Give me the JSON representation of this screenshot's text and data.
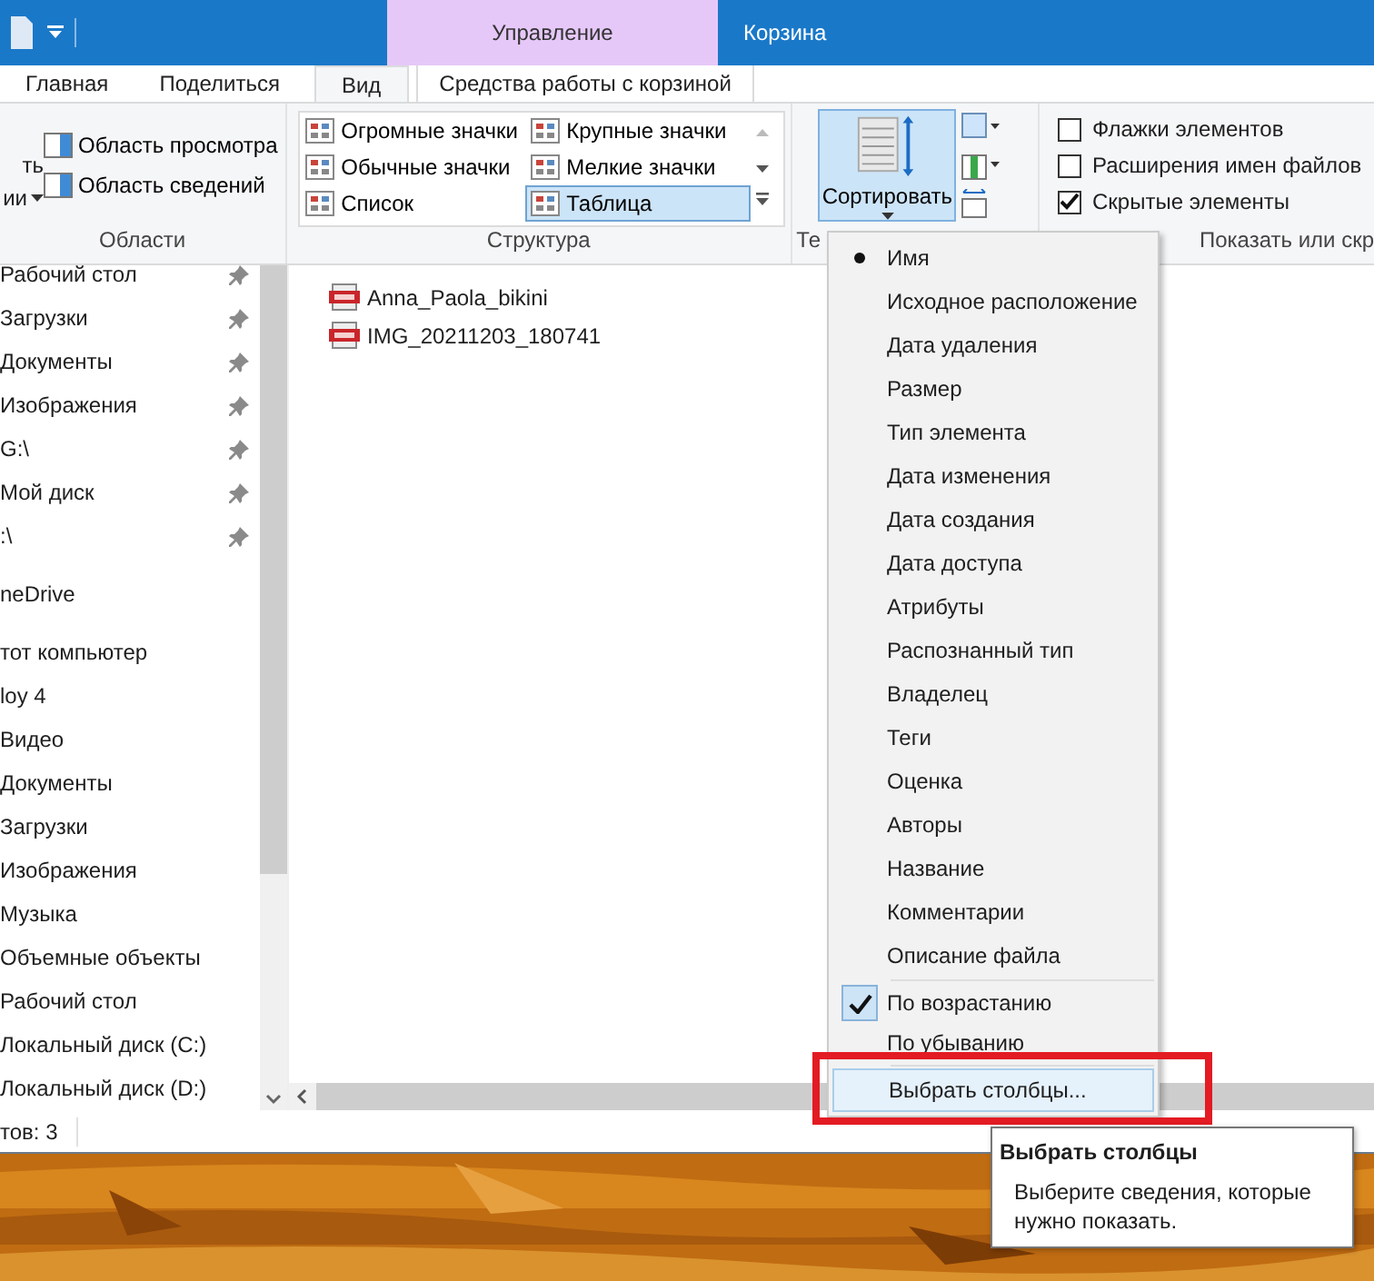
{
  "window": {
    "contextual_group": "Управление",
    "title": "Корзина"
  },
  "tabs": [
    {
      "label": "Главная",
      "selected": false
    },
    {
      "label": "Поделиться",
      "selected": false
    },
    {
      "label": "Вид",
      "selected": true
    },
    {
      "label": "Средства работы с корзиной",
      "selected": false
    }
  ],
  "ribbon": {
    "panes_group": {
      "label": "Области",
      "cut_button": [
        "ть",
        "ии"
      ],
      "buttons": [
        "Область просмотра",
        "Область сведений"
      ]
    },
    "layout_group": {
      "label": "Структура",
      "options": [
        {
          "label": "Огромные значки",
          "selected": false
        },
        {
          "label": "Крупные значки",
          "selected": false
        },
        {
          "label": "Обычные значки",
          "selected": false
        },
        {
          "label": "Мелкие значки",
          "selected": false
        },
        {
          "label": "Список",
          "selected": false
        },
        {
          "label": "Таблица",
          "selected": true
        }
      ]
    },
    "view_group": {
      "label": "Те",
      "sort_button": "Сортировать"
    },
    "show_group": {
      "label": "Показать или скр",
      "checkboxes": [
        {
          "label": "Флажки элементов",
          "checked": false
        },
        {
          "label": "Расширения имен файлов",
          "checked": false
        },
        {
          "label": "Скрытые элементы",
          "checked": true
        }
      ]
    }
  },
  "nav": [
    {
      "items": [
        {
          "label": "Рабочий стол",
          "pinned": true
        },
        {
          "label": "Загрузки",
          "pinned": true
        },
        {
          "label": "Документы",
          "pinned": true
        },
        {
          "label": "Изображения",
          "pinned": true
        },
        {
          "label": "G:\\",
          "pinned": true
        },
        {
          "label": "Мой диск",
          "pinned": true
        },
        {
          "label": ":\\",
          "pinned": true
        }
      ]
    },
    {
      "items": [
        {
          "label": "neDrive",
          "pinned": false
        }
      ]
    },
    {
      "items": [
        {
          "label": "тот компьютер",
          "pinned": false
        },
        {
          "label": "loy 4",
          "pinned": false
        },
        {
          "label": "Видео",
          "pinned": false
        },
        {
          "label": "Документы",
          "pinned": false
        },
        {
          "label": "Загрузки",
          "pinned": false
        },
        {
          "label": "Изображения",
          "pinned": false
        },
        {
          "label": "Музыка",
          "pinned": false
        },
        {
          "label": "Объемные объекты",
          "pinned": false
        },
        {
          "label": "Рабочий стол",
          "pinned": false
        },
        {
          "label": "Локальный диск (C:)",
          "pinned": false
        },
        {
          "label": "Локальный диск (D:)",
          "pinned": false
        }
      ]
    }
  ],
  "files": [
    {
      "name": "Anna_Paola_bikini"
    },
    {
      "name": "IMG_20211203_180741"
    }
  ],
  "status_bar": "тов: 3",
  "sort_menu": {
    "fields": [
      {
        "label": "Имя",
        "selected": true
      },
      {
        "label": "Исходное расположение",
        "selected": false
      },
      {
        "label": "Дата удаления",
        "selected": false
      },
      {
        "label": "Размер",
        "selected": false
      },
      {
        "label": "Тип элемента",
        "selected": false
      },
      {
        "label": "Дата изменения",
        "selected": false
      },
      {
        "label": "Дата создания",
        "selected": false
      },
      {
        "label": "Дата доступа",
        "selected": false
      },
      {
        "label": "Атрибуты",
        "selected": false
      },
      {
        "label": "Распознанный тип",
        "selected": false
      },
      {
        "label": "Владелец",
        "selected": false
      },
      {
        "label": "Теги",
        "selected": false
      },
      {
        "label": "Оценка",
        "selected": false
      },
      {
        "label": "Авторы",
        "selected": false
      },
      {
        "label": "Название",
        "selected": false
      },
      {
        "label": "Комментарии",
        "selected": false
      },
      {
        "label": "Описание файла",
        "selected": false
      }
    ],
    "order": [
      {
        "label": "По возрастанию",
        "selected": true
      },
      {
        "label": "По убыванию",
        "selected": false
      }
    ],
    "command": {
      "label": "Выбрать столбцы...",
      "highlighted": true
    }
  },
  "tooltip": {
    "title": "Выбрать столбцы",
    "text": "Выберите сведения, которые нужно показать."
  },
  "highlight_frame": true
}
